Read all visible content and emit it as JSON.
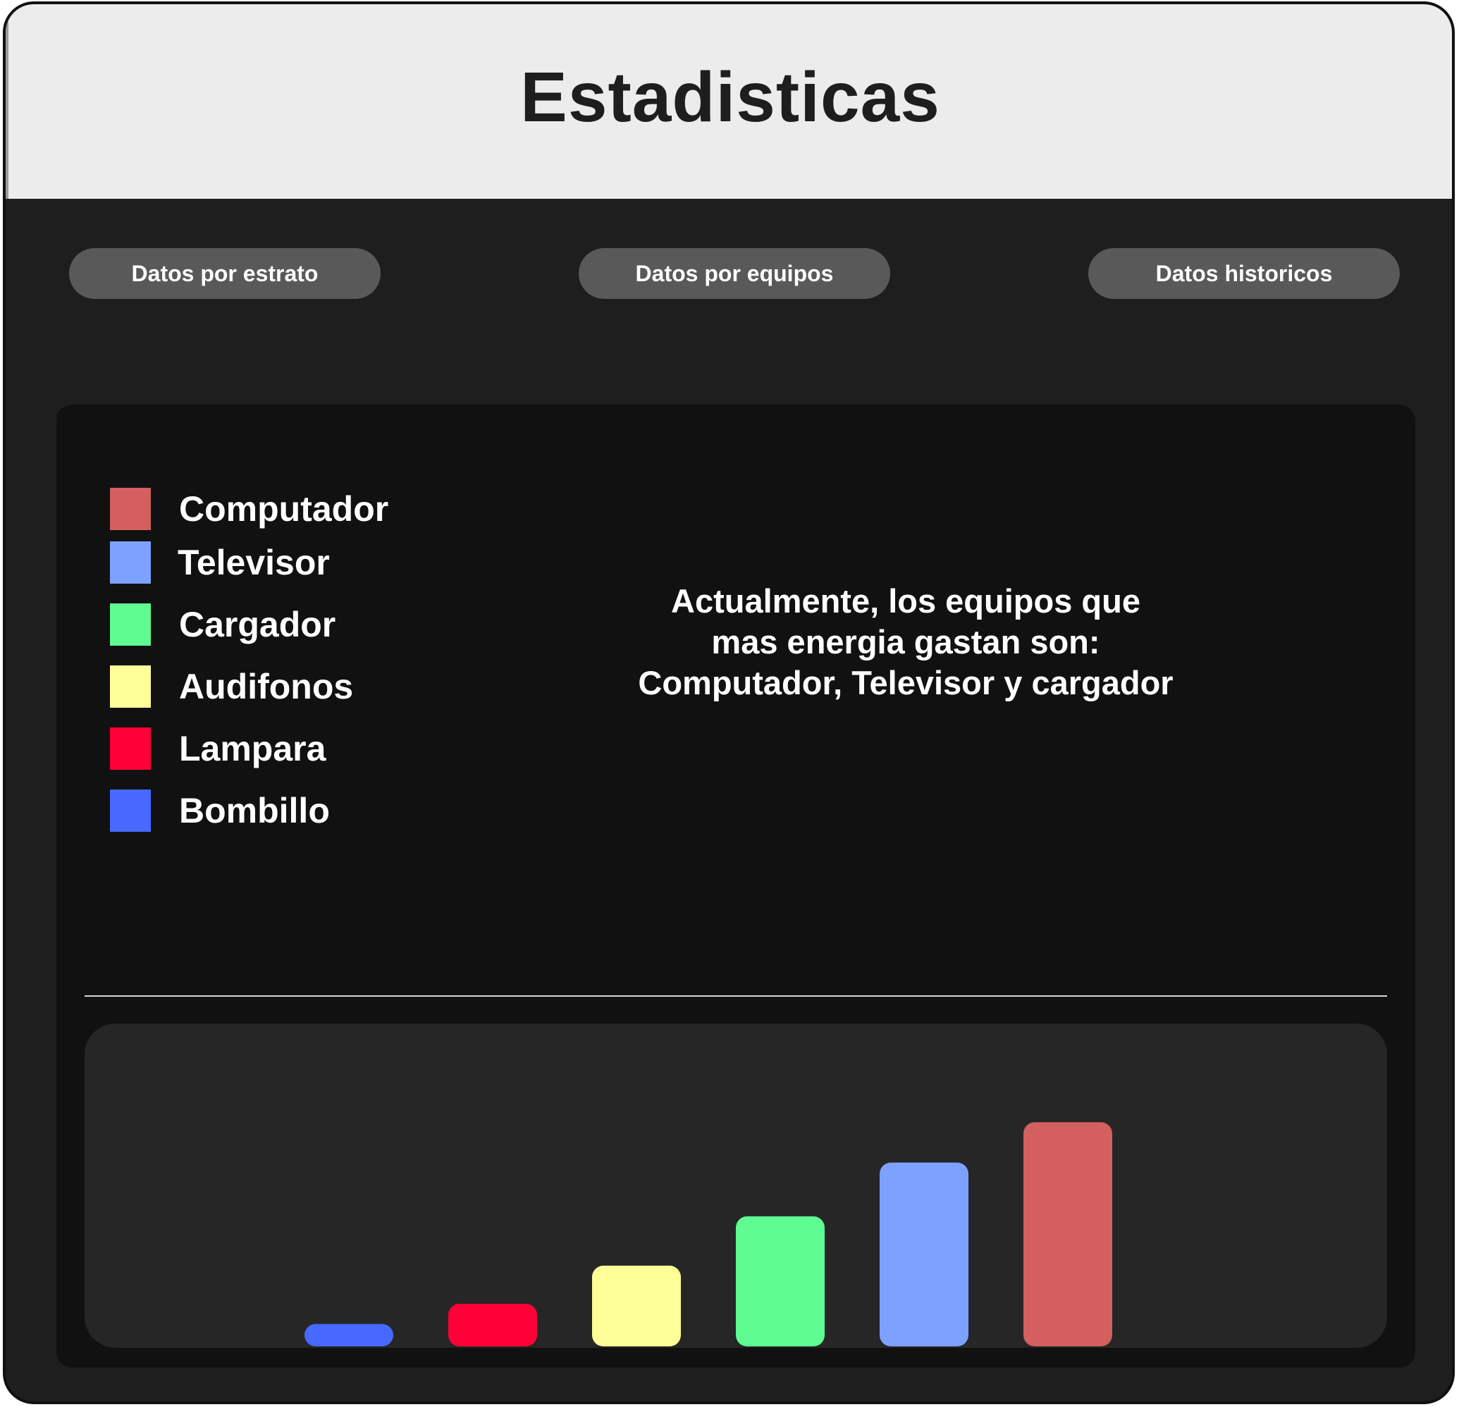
{
  "header": {
    "title": "Estadisticas"
  },
  "tabs": [
    {
      "label": "Datos por estrato"
    },
    {
      "label": "Datos por equipos"
    },
    {
      "label": "Datos historicos"
    }
  ],
  "legend": [
    {
      "label": "Computador",
      "color": "#d35f5f"
    },
    {
      "label": "Televisor",
      "color": "#7da1ff"
    },
    {
      "label": "Cargador",
      "color": "#5ffd91"
    },
    {
      "label": "Audifonos",
      "color": "#ffff99"
    },
    {
      "label": "Lampara",
      "color": "#ff0038"
    },
    {
      "label": "Bombillo",
      "color": "#4769ff"
    }
  ],
  "summary": {
    "line1": "Actualmente, los equipos que",
    "line2": "mas energia gastan son:",
    "line3": "Computador, Televisor y cargador"
  },
  "chart_data": {
    "type": "bar",
    "categories": [
      "Bombillo",
      "Lampara",
      "Audifonos",
      "Cargador",
      "Televisor",
      "Computador"
    ],
    "values": [
      10,
      19,
      36,
      58,
      82,
      100
    ],
    "colors": [
      "#4769ff",
      "#ff0038",
      "#ffff99",
      "#5ffd91",
      "#7da1ff",
      "#d35f5f"
    ],
    "ylim": [
      0,
      100
    ],
    "xlabel": "",
    "ylabel": "",
    "grid": false
  }
}
